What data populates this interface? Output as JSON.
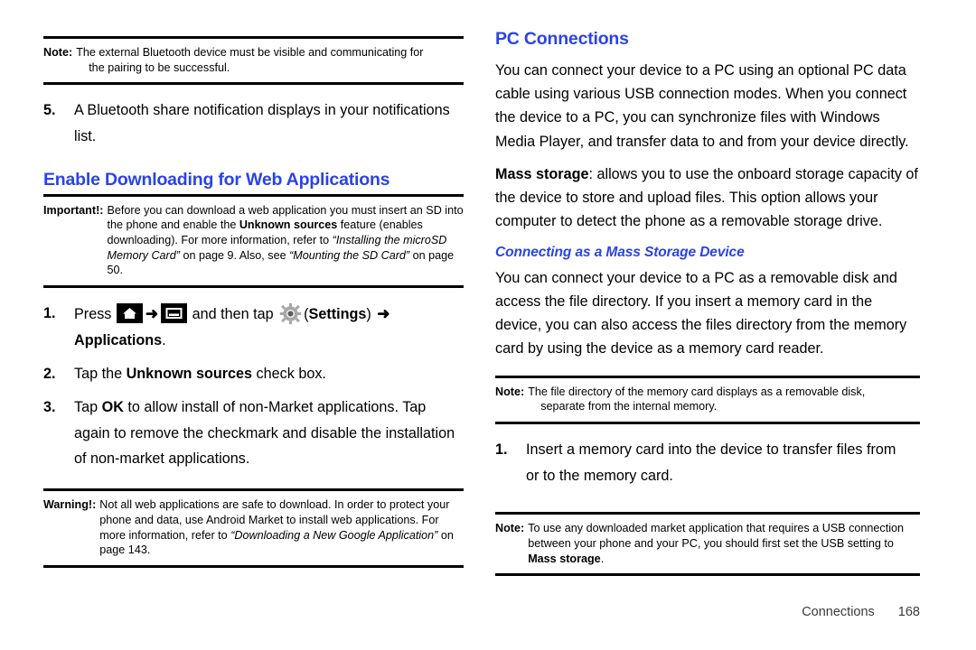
{
  "document": {
    "title": "Connections — PC Connections",
    "accent_color": "#2a43e8",
    "rule_color": "#000000"
  },
  "left_column": {
    "note_bluetooth": {
      "label": "Note:",
      "line1": "The external Bluetooth device must be visible and communicating for",
      "line2": "the pairing to be successful."
    },
    "step5": {
      "number": "5.",
      "line1": "A Bluetooth share notification displays in your notifications",
      "line2": "list."
    },
    "heading": "Enable Downloading for Web Applications",
    "note_important": {
      "label": "Important!:",
      "seg1": "Before you can download a web application you must insert an SD into the phone and enable the ",
      "seg2_bold": "Unknown sources",
      "seg3": " feature (enables downloading). For more information, refer to ",
      "seg4_italic": "“Installing the microSD Memory Card”",
      "seg5": " on page 9. Also, see ",
      "seg6_italic": "“Mounting the SD Card”",
      "seg7": " on page 50."
    },
    "steps": {
      "one": {
        "number": "1.",
        "seg1": "Press",
        "icon_home": "home-icon",
        "arrow1": "➜",
        "icon_menu": "menu-icon",
        "seg2": "and then tap",
        "icon_gear": "gear-icon",
        "seg3": "(",
        "settings_bold": "Settings",
        "seg4": ")",
        "arrow2": "➜",
        "applications_bold": "Applications",
        "seg5": "."
      },
      "two": {
        "number": "2.",
        "seg1": "Tap the ",
        "bold": "Unknown sources",
        "seg2": " check box."
      },
      "three": {
        "number": "3.",
        "seg1": "Tap ",
        "bold": "OK",
        "seg2": " to allow install of non-Market applications. Tap again to remove the checkmark and disable the installation of non-market applications."
      }
    },
    "note_warning": {
      "label": "Warning!:",
      "seg1": "Not all web applications are safe to download. In order to protect your phone and data, use Android Market to install web applications. For more information, refer to ",
      "seg2_italic": "“Downloading a New Google Application”",
      "seg3": " on page 143."
    }
  },
  "right_column": {
    "heading": "PC Connections",
    "para_intro": "You can connect your device to a PC using an optional PC data cable using various USB connection modes. When you connect the device to a PC, you can synchronize files with Windows Media Player, and transfer data to and from your device directly.",
    "para_mass_storage": {
      "bold": "Mass storage",
      "rest": ": allows you to use the onboard storage capacity of the device to store and upload files. This option allows your computer to detect the phone as a removable storage drive."
    },
    "subheading": "Connecting as a Mass Storage Device",
    "para_connect": "You can connect your device to a PC as a removable disk and access the file directory. If you insert a memory card in the device, you can also access the files directory from the memory card by using the device as a memory card reader.",
    "note_file_directory": {
      "label": "Note:",
      "line1": "The file directory of the memory card displays as a removable disk,",
      "line2": "separate from the internal memory."
    },
    "step1": {
      "number": "1.",
      "line1": "Insert a memory card into the device to transfer files from",
      "line2": "or to the memory card."
    },
    "note_usb": {
      "label": "Note:",
      "seg1": "To use any downloaded market application that requires a USB connection between your phone and your PC, you should first set the USB setting to ",
      "seg2_bold": "Mass storage",
      "seg3": "."
    }
  },
  "footer": {
    "chapter": "Connections",
    "page_number": "168"
  }
}
